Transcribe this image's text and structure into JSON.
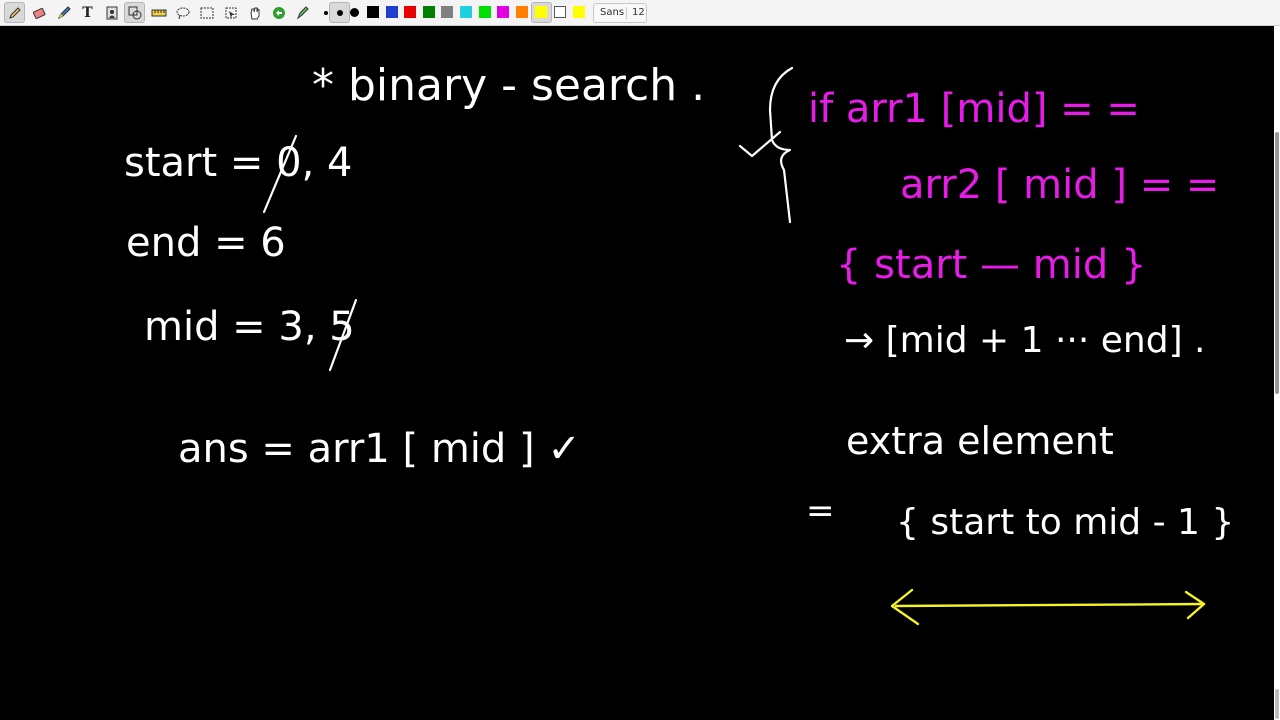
{
  "toolbar": {
    "tools": [
      "pen",
      "eraser",
      "highlighter",
      "text",
      "image",
      "shape",
      "ruler",
      "select-region",
      "select-rect",
      "hand",
      "undo",
      "redo"
    ],
    "pen_sizes": [
      "small",
      "medium",
      "large"
    ],
    "colors": [
      "#000000",
      "#1f3fcf",
      "#e60000",
      "#008000",
      "#808080",
      "#1fd0e0",
      "#00e000",
      "#e000e0",
      "#ff8000",
      "#ffff00",
      "#ffffff",
      "#ffff00"
    ],
    "selected_color": "#ffff00",
    "font_name": "Sans",
    "font_size": "12"
  },
  "ink_colors": {
    "white": "#ffffff",
    "magenta": "#e81ce8",
    "yellow": "#f4f426"
  },
  "notes": {
    "title": "* binary - search .",
    "start": "start = 0, 4",
    "end": "end = 6",
    "mid": "mid = 3, 5",
    "ans": "ans = arr1 [ mid ] ✓",
    "cond1": "if arr1 [mid] = =",
    "cond2": "arr2 [ mid ] = =",
    "range1": "{ start — mid }",
    "range2": "→ [mid + 1 ··· end] .",
    "extra": "extra element",
    "eq": "=",
    "range3": "{ start to mid - 1 }"
  }
}
